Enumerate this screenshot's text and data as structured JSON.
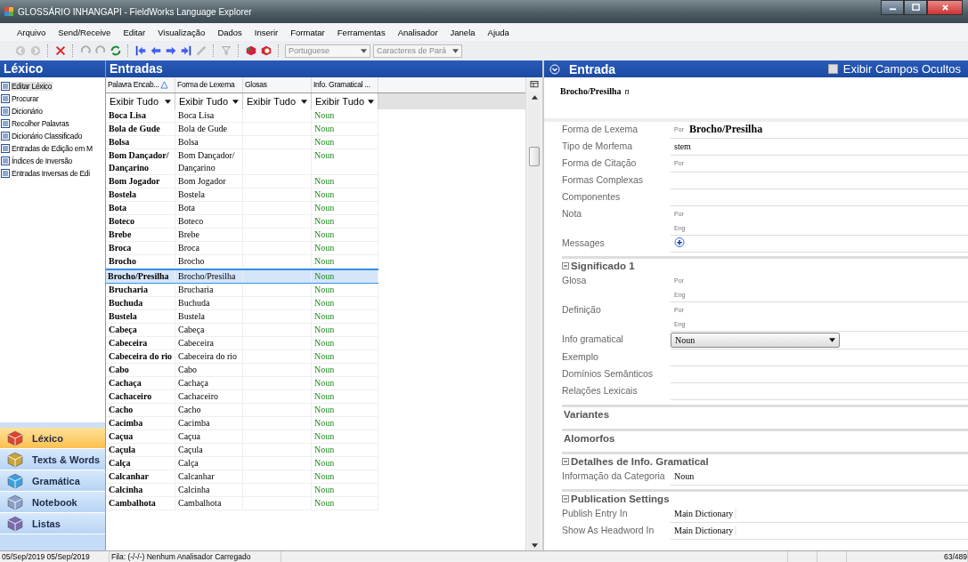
{
  "window": {
    "title": "GLOSSÁRIO INHANGAPI - FieldWorks Language Explorer"
  },
  "menu": [
    "Arquivo",
    "Send/Receive",
    "Editar",
    "Visualização",
    "Dados",
    "Inserir",
    "Formatar",
    "Ferramentas",
    "Analisador",
    "Janela",
    "Ajuda"
  ],
  "toolbar": {
    "vernacular": "Portuguese",
    "writing_system": "Caracteres de Pará"
  },
  "sidebar": {
    "title": "Léxico",
    "tools": [
      {
        "label": "Editar Léxico",
        "selected": true
      },
      {
        "label": "Procurar",
        "selected": false
      },
      {
        "label": "Dicionário",
        "selected": false
      },
      {
        "label": "Recolher Palavras",
        "selected": false
      },
      {
        "label": "Dicionário Classificado",
        "selected": false
      },
      {
        "label": "Entradas de Edição em M",
        "selected": false
      },
      {
        "label": "Índices de Inversão",
        "selected": false
      },
      {
        "label": "Entradas Inversas de Edi",
        "selected": false
      }
    ],
    "areas": [
      {
        "label": "Léxico",
        "selected": true
      },
      {
        "label": "Texts & Words",
        "selected": false
      },
      {
        "label": "Gramática",
        "selected": false
      },
      {
        "label": "Notebook",
        "selected": false
      },
      {
        "label": "Listas",
        "selected": false
      }
    ]
  },
  "entries": {
    "title": "Entradas",
    "columns": [
      "Palavra Encab...",
      "Forma de Lexema",
      "Glosas",
      "Info. Gramatical ..."
    ],
    "filters": [
      "Exibir Tudo",
      "Exibir Tudo",
      "Exibir Tudo",
      "Exibir Tudo"
    ],
    "rows": [
      {
        "headword": "Boca Lisa",
        "lexeme": "Boca Lisa",
        "category": "Noun",
        "selected": false
      },
      {
        "headword": "Bola de Gude",
        "lexeme": "Bola de Gude",
        "category": "Noun",
        "selected": false
      },
      {
        "headword": "Bolsa",
        "lexeme": "Bolsa",
        "category": "Noun",
        "selected": false
      },
      {
        "headword": "Bom Dançador/ Dançarino",
        "lexeme": "Bom Dançador/ Dançarino",
        "category": "Noun",
        "selected": false
      },
      {
        "headword": "Bom Jogador",
        "lexeme": "Bom Jogador",
        "category": "Noun",
        "selected": false
      },
      {
        "headword": "Bostela",
        "lexeme": "Bostela",
        "category": "Noun",
        "selected": false
      },
      {
        "headword": "Bota",
        "lexeme": "Bota",
        "category": "Noun",
        "selected": false
      },
      {
        "headword": "Boteco",
        "lexeme": "Boteco",
        "category": "Noun",
        "selected": false
      },
      {
        "headword": "Brebe",
        "lexeme": "Brebe",
        "category": "Noun",
        "selected": false
      },
      {
        "headword": "Broca",
        "lexeme": "Broca",
        "category": "Noun",
        "selected": false
      },
      {
        "headword": "Brocho",
        "lexeme": "Brocho",
        "category": "Noun",
        "selected": false
      },
      {
        "headword": "Brocho/Presilha",
        "lexeme": "Brocho/Presilha",
        "category": "Noun",
        "selected": true
      },
      {
        "headword": "Brucharia",
        "lexeme": "Brucharia",
        "category": "Noun",
        "selected": false
      },
      {
        "headword": "Buchuda",
        "lexeme": "Buchuda",
        "category": "Noun",
        "selected": false
      },
      {
        "headword": "Bustela",
        "lexeme": "Bustela",
        "category": "Noun",
        "selected": false
      },
      {
        "headword": "Cabeça",
        "lexeme": "Cabeça",
        "category": "Noun",
        "selected": false
      },
      {
        "headword": "Cabeceira",
        "lexeme": "Cabeceira",
        "category": "Noun",
        "selected": false
      },
      {
        "headword": "Cabeceira do rio",
        "lexeme": "Cabeceira do rio",
        "category": "Noun",
        "selected": false
      },
      {
        "headword": "Cabo",
        "lexeme": "Cabo",
        "category": "Noun",
        "selected": false
      },
      {
        "headword": "Cachaça",
        "lexeme": "Cachaça",
        "category": "Noun",
        "selected": false
      },
      {
        "headword": "Cachaceiro",
        "lexeme": "Cachaceiro",
        "category": "Noun",
        "selected": false
      },
      {
        "headword": "Cacho",
        "lexeme": "Cacho",
        "category": "Noun",
        "selected": false
      },
      {
        "headword": "Cacimba",
        "lexeme": "Cacimba",
        "category": "Noun",
        "selected": false
      },
      {
        "headword": "Caçua",
        "lexeme": "Caçua",
        "category": "Noun",
        "selected": false
      },
      {
        "headword": "Caçula",
        "lexeme": "Caçula",
        "category": "Noun",
        "selected": false
      },
      {
        "headword": "Calça",
        "lexeme": "Calça",
        "category": "Noun",
        "selected": false
      },
      {
        "headword": "Calcanhar",
        "lexeme": "Calcanhar",
        "category": "Noun",
        "selected": false
      },
      {
        "headword": "Calcinha",
        "lexeme": "Calcinha",
        "category": "Noun",
        "selected": false
      },
      {
        "headword": "Cambalhota",
        "lexeme": "Cambalhota",
        "category": "Noun",
        "selected": false
      }
    ]
  },
  "detail": {
    "title": "Entrada",
    "show_hidden": {
      "label": "Exibir Campos Ocultos",
      "checked": false
    },
    "headword": "Brocho/Presilha",
    "pos": "n",
    "items": [
      {
        "kind": "field",
        "label": "Forma de Lexema",
        "lines": [
          {
            "ws": "Por",
            "value": "Brocho/Presilha",
            "big": true
          }
        ]
      },
      {
        "kind": "field",
        "label": "Tipo de Morfema",
        "lines": [
          {
            "value": "stem"
          }
        ]
      },
      {
        "kind": "field",
        "label": "Forma de Citação",
        "lines": [
          {
            "ws": "Por"
          }
        ]
      },
      {
        "kind": "field",
        "label": "Formas Complexas"
      },
      {
        "kind": "field",
        "label": "Componentes"
      },
      {
        "kind": "field",
        "label": "Nota",
        "lines": [
          {
            "ws": "Por"
          },
          {
            "ws": "Eng"
          }
        ]
      },
      {
        "kind": "messages",
        "label": "Messages"
      },
      {
        "kind": "section",
        "title": "Significado 1",
        "expanded": true
      },
      {
        "kind": "field",
        "label": "Glosa",
        "lines": [
          {
            "ws": "Por"
          },
          {
            "ws": "Eng"
          }
        ]
      },
      {
        "kind": "field",
        "label": "Definição",
        "lines": [
          {
            "ws": "Por"
          },
          {
            "ws": "Eng"
          }
        ]
      },
      {
        "kind": "combo",
        "label": "Info gramatical",
        "value": "Noun"
      },
      {
        "kind": "field",
        "label": "Exemplo"
      },
      {
        "kind": "field",
        "label": "Domínios Semânticos"
      },
      {
        "kind": "field",
        "label": "Relações Lexicais"
      },
      {
        "kind": "group",
        "title": "Variantes"
      },
      {
        "kind": "group",
        "title": "Alomorfos"
      },
      {
        "kind": "section",
        "title": "Detalhes de Info. Gramatical",
        "expanded": true
      },
      {
        "kind": "field",
        "label": "Informação da Categoria",
        "lines": [
          {
            "value": "Noun"
          }
        ]
      },
      {
        "kind": "section",
        "title": "Publication Settings",
        "expanded": true
      },
      {
        "kind": "field",
        "label": "Publish Entry In",
        "lines": [
          {
            "value": "Main Dictionary",
            "boxed": true
          }
        ]
      },
      {
        "kind": "field",
        "label": "Show As Headword In",
        "lines": [
          {
            "value": "Main Dictionary",
            "boxed": true
          }
        ]
      }
    ]
  },
  "status_bar": {
    "dates": "05/Sep/2019 05/Sep/2019",
    "parser": "Fila: (-/-/-) Nenhum Analisador Carregado",
    "count": "63/489"
  }
}
